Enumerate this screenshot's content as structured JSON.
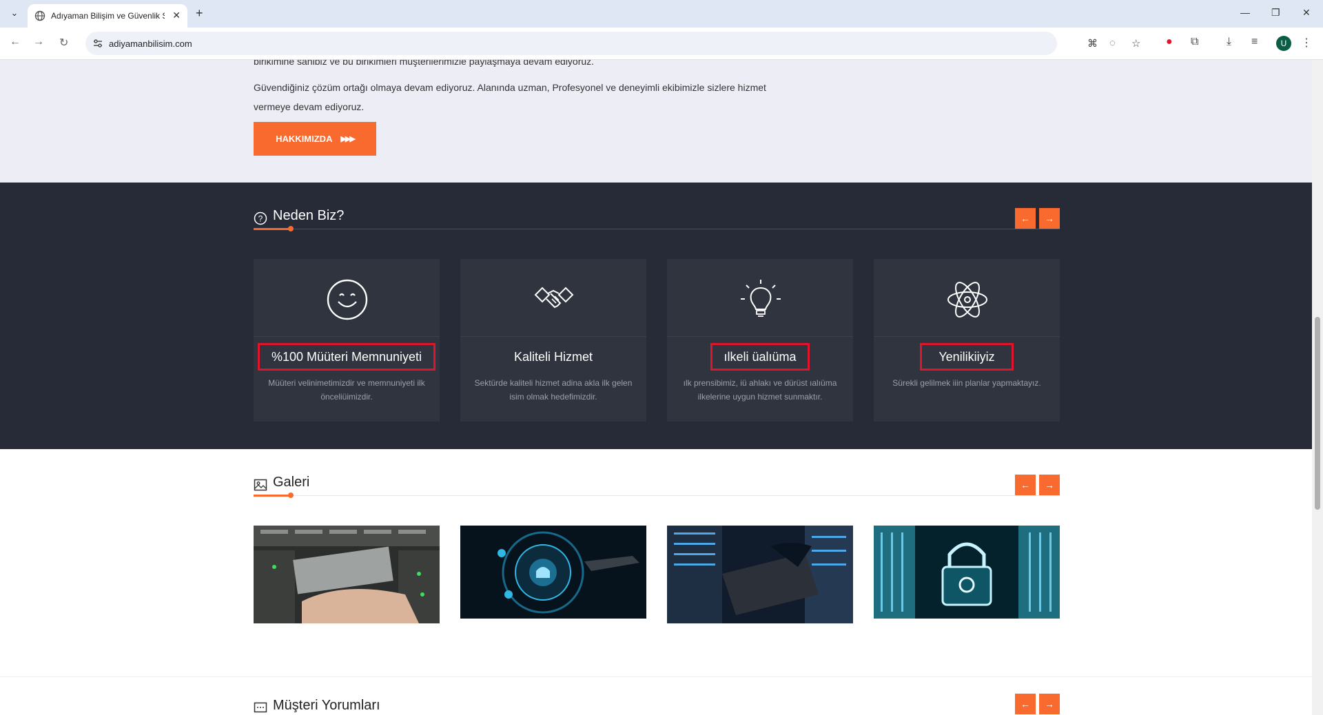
{
  "browser": {
    "tab_title": "Adıyaman Bilişim ve Güvenlik S",
    "url": "adiyamanbilisim.com",
    "avatar_letter": "U"
  },
  "about": {
    "line1": "birikimine sahibiz ve bu birikimleri müşterilerimizle paylaşmaya devam ediyoruz.",
    "line2": "Güvendiğiniz çözüm ortağı olmaya devam ediyoruz. Alanında uzman, Profesyonel ve deneyimli ekibimizle sizlere hizmet",
    "line3": "vermeye devam ediyoruz.",
    "button_label": "HAKKIMIZDA"
  },
  "why": {
    "title": "Neden Biz?",
    "cards": [
      {
        "title": "%100 Müüteri Memnuniyeti",
        "desc": "Müüteri velinimetimizdir ve memnuniyeti ilk önceliüimizdir.",
        "icon": "smile-icon",
        "highlighted": true
      },
      {
        "title": "Kaliteli Hizmet",
        "desc": "Sektürde kaliteli hizmet adina akla ilk gelen isim olmak hedefimizdir.",
        "icon": "handshake-icon",
        "highlighted": false
      },
      {
        "title": "ılkeli üalıüma",
        "desc": "ılk prensibimiz, iü ahlakı ve dürüst ıalıüma ilkelerine uygun hizmet sunmaktır.",
        "icon": "lightbulb-icon",
        "highlighted": true
      },
      {
        "title": "Yenilikiiyiz",
        "desc": "Sürekli gelilmek iiin planlar yapmaktayız.",
        "icon": "atom-icon",
        "highlighted": true
      }
    ]
  },
  "gallery": {
    "title": "Galeri",
    "images": [
      "server-hand-image",
      "cloud-security-image",
      "datacenter-laptop-image",
      "lock-datacenter-image"
    ]
  },
  "reviews": {
    "title": "Müşteri Yorumları"
  },
  "colors": {
    "accent": "#f96a2f",
    "dark_bg": "#272b38",
    "highlight_box": "#e0152c"
  }
}
